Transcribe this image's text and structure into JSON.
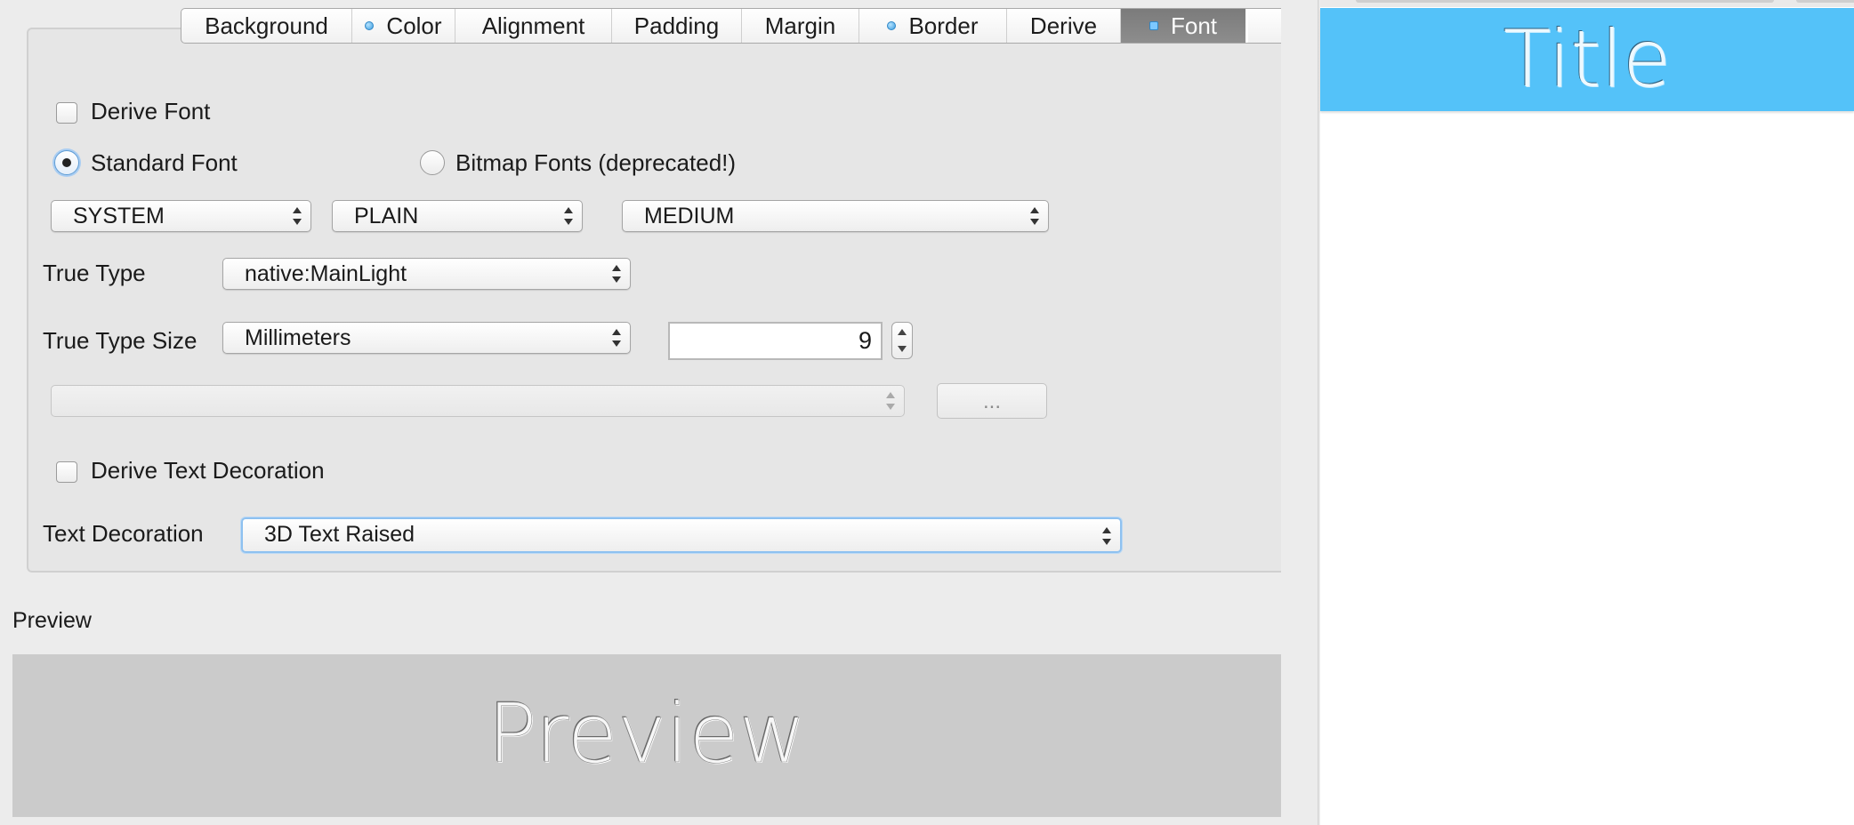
{
  "tabs": [
    {
      "label": "Background",
      "marker": "none",
      "active": false
    },
    {
      "label": "Color",
      "marker": "dot",
      "active": false
    },
    {
      "label": "Alignment",
      "marker": "none",
      "active": false
    },
    {
      "label": "Padding",
      "marker": "none",
      "active": false
    },
    {
      "label": "Margin",
      "marker": "none",
      "active": false
    },
    {
      "label": "Border",
      "marker": "dot",
      "active": false
    },
    {
      "label": "Derive",
      "marker": "none",
      "active": false
    },
    {
      "label": "Font",
      "marker": "square",
      "active": true
    }
  ],
  "font_panel": {
    "derive_font": {
      "label": "Derive Font",
      "checked": false
    },
    "standard_font": {
      "label": "Standard Font",
      "selected": true
    },
    "bitmap_fonts": {
      "label": "Bitmap Fonts (deprecated!)",
      "selected": false
    },
    "face": "SYSTEM",
    "style": "PLAIN",
    "size": "MEDIUM",
    "true_type_label": "True Type",
    "true_type_value": "native:MainLight",
    "true_type_size_label": "True Type Size",
    "true_type_size_unit": "Millimeters",
    "true_type_size_value": "9",
    "font_file_value": "",
    "browse_label": "...",
    "derive_text_decoration": {
      "label": "Derive Text Decoration",
      "checked": false
    },
    "text_decoration_label": "Text Decoration",
    "text_decoration_value": "3D Text Raised"
  },
  "preview": {
    "heading": "Preview",
    "sample_text": "Preview"
  },
  "simulator": {
    "title_text": "Title",
    "title_bar_color": "#54c2f9"
  }
}
